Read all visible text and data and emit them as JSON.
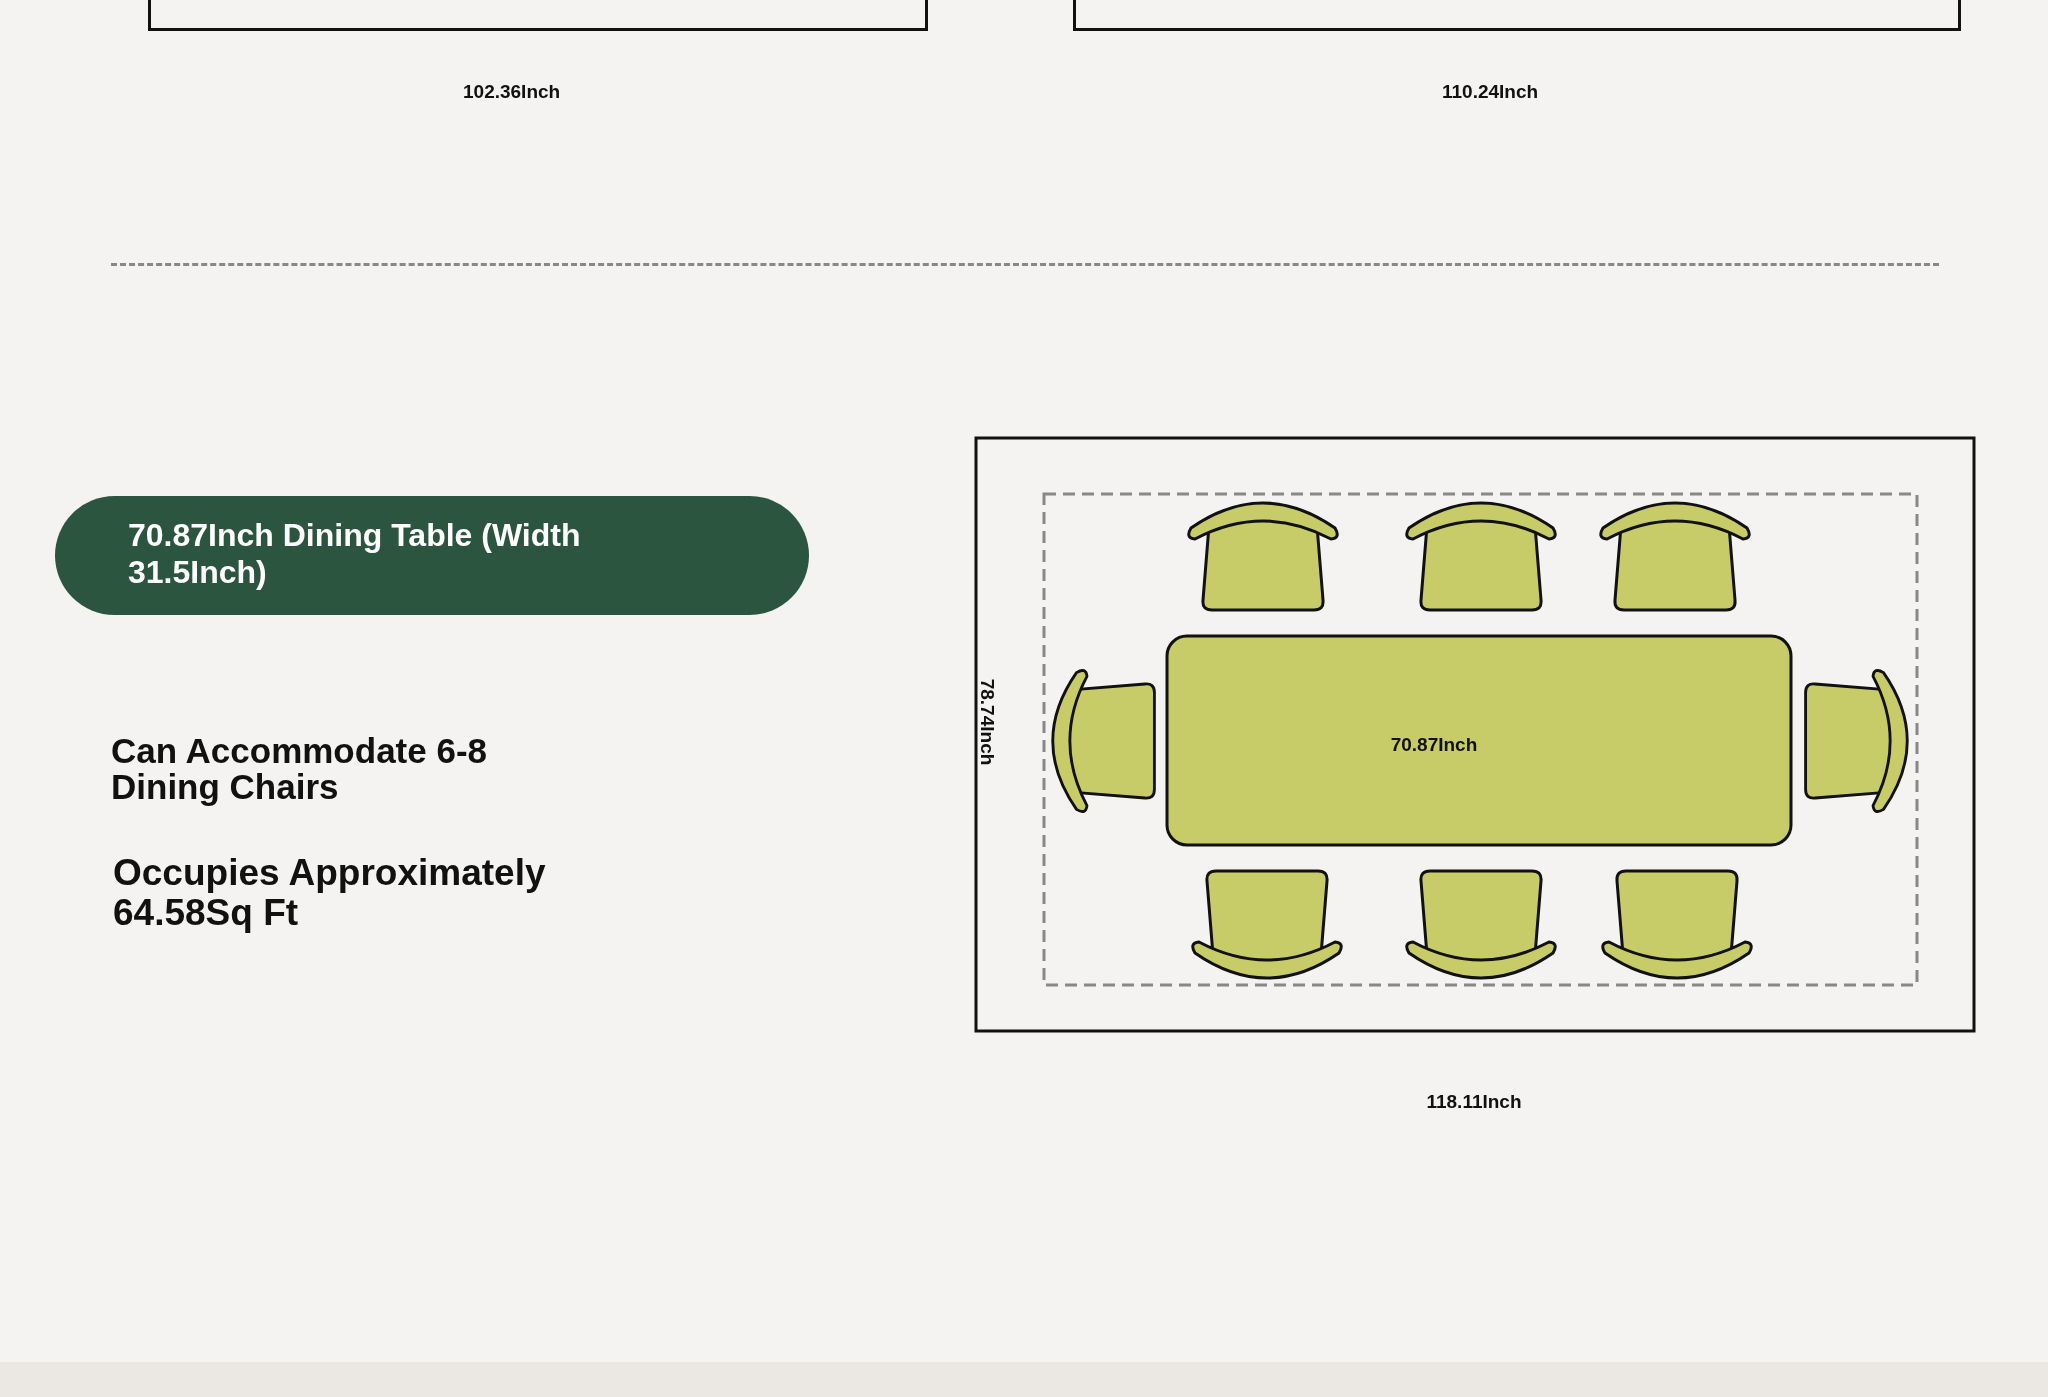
{
  "top_plans": [
    {
      "dimension": "102.36Inch"
    },
    {
      "dimension": "110.24Inch"
    }
  ],
  "banner": {
    "title": "70.87Inch Dining Table (Width 31.5Inch)"
  },
  "features": [
    "Can Accommodate 6-8 Dining Chairs",
    "Occupies Approximately 64.58Sq Ft"
  ],
  "floor_plan": {
    "side_dimension": "78.74Inch",
    "table_dimension": "70.87Inch",
    "bottom_dimension": "118.11Inch"
  }
}
